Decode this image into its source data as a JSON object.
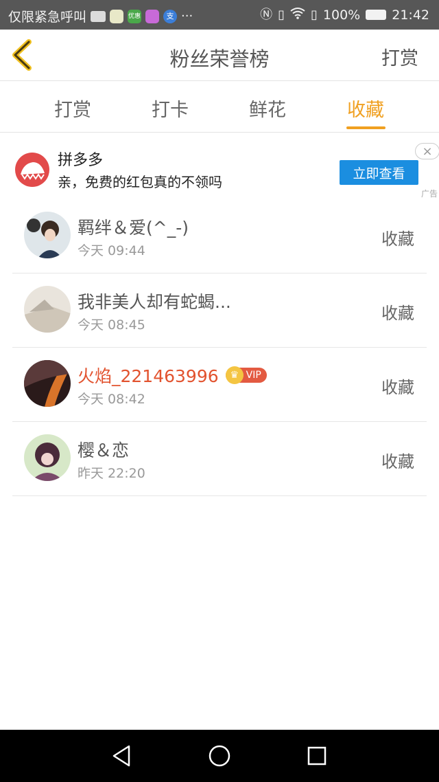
{
  "status_bar": {
    "carrier_text": "仅限紧急呼叫",
    "battery": "100%",
    "time": "21:42",
    "app_icon_labels": [
      "优惠",
      "支"
    ]
  },
  "header": {
    "title": "粉丝荣誉榜",
    "action": "打赏"
  },
  "tabs": [
    {
      "label": "打赏",
      "active": false
    },
    {
      "label": "打卡",
      "active": false
    },
    {
      "label": "鲜花",
      "active": false
    },
    {
      "label": "收藏",
      "active": true
    }
  ],
  "ad": {
    "title": "拼多多",
    "description": "亲，免费的红包真的不领吗",
    "button": "立即查看",
    "tag": "广告"
  },
  "fans": [
    {
      "name": "羁绊＆爱(^_-)",
      "time": "今天 09:44",
      "action": "收藏",
      "vip": false
    },
    {
      "name": "我非美人却有蛇蝎...",
      "time": "今天 08:45",
      "action": "收藏",
      "vip": false
    },
    {
      "name": "火焰_221463996",
      "time": "今天 08:42",
      "action": "收藏",
      "vip": true,
      "vip_label": "VIP"
    },
    {
      "name": "樱＆恋",
      "time": "昨天 22:20",
      "action": "收藏",
      "vip": false
    }
  ],
  "colors": {
    "accent": "#f0a021",
    "vip_name": "#e2532f",
    "ad_button": "#1b8ee0"
  }
}
